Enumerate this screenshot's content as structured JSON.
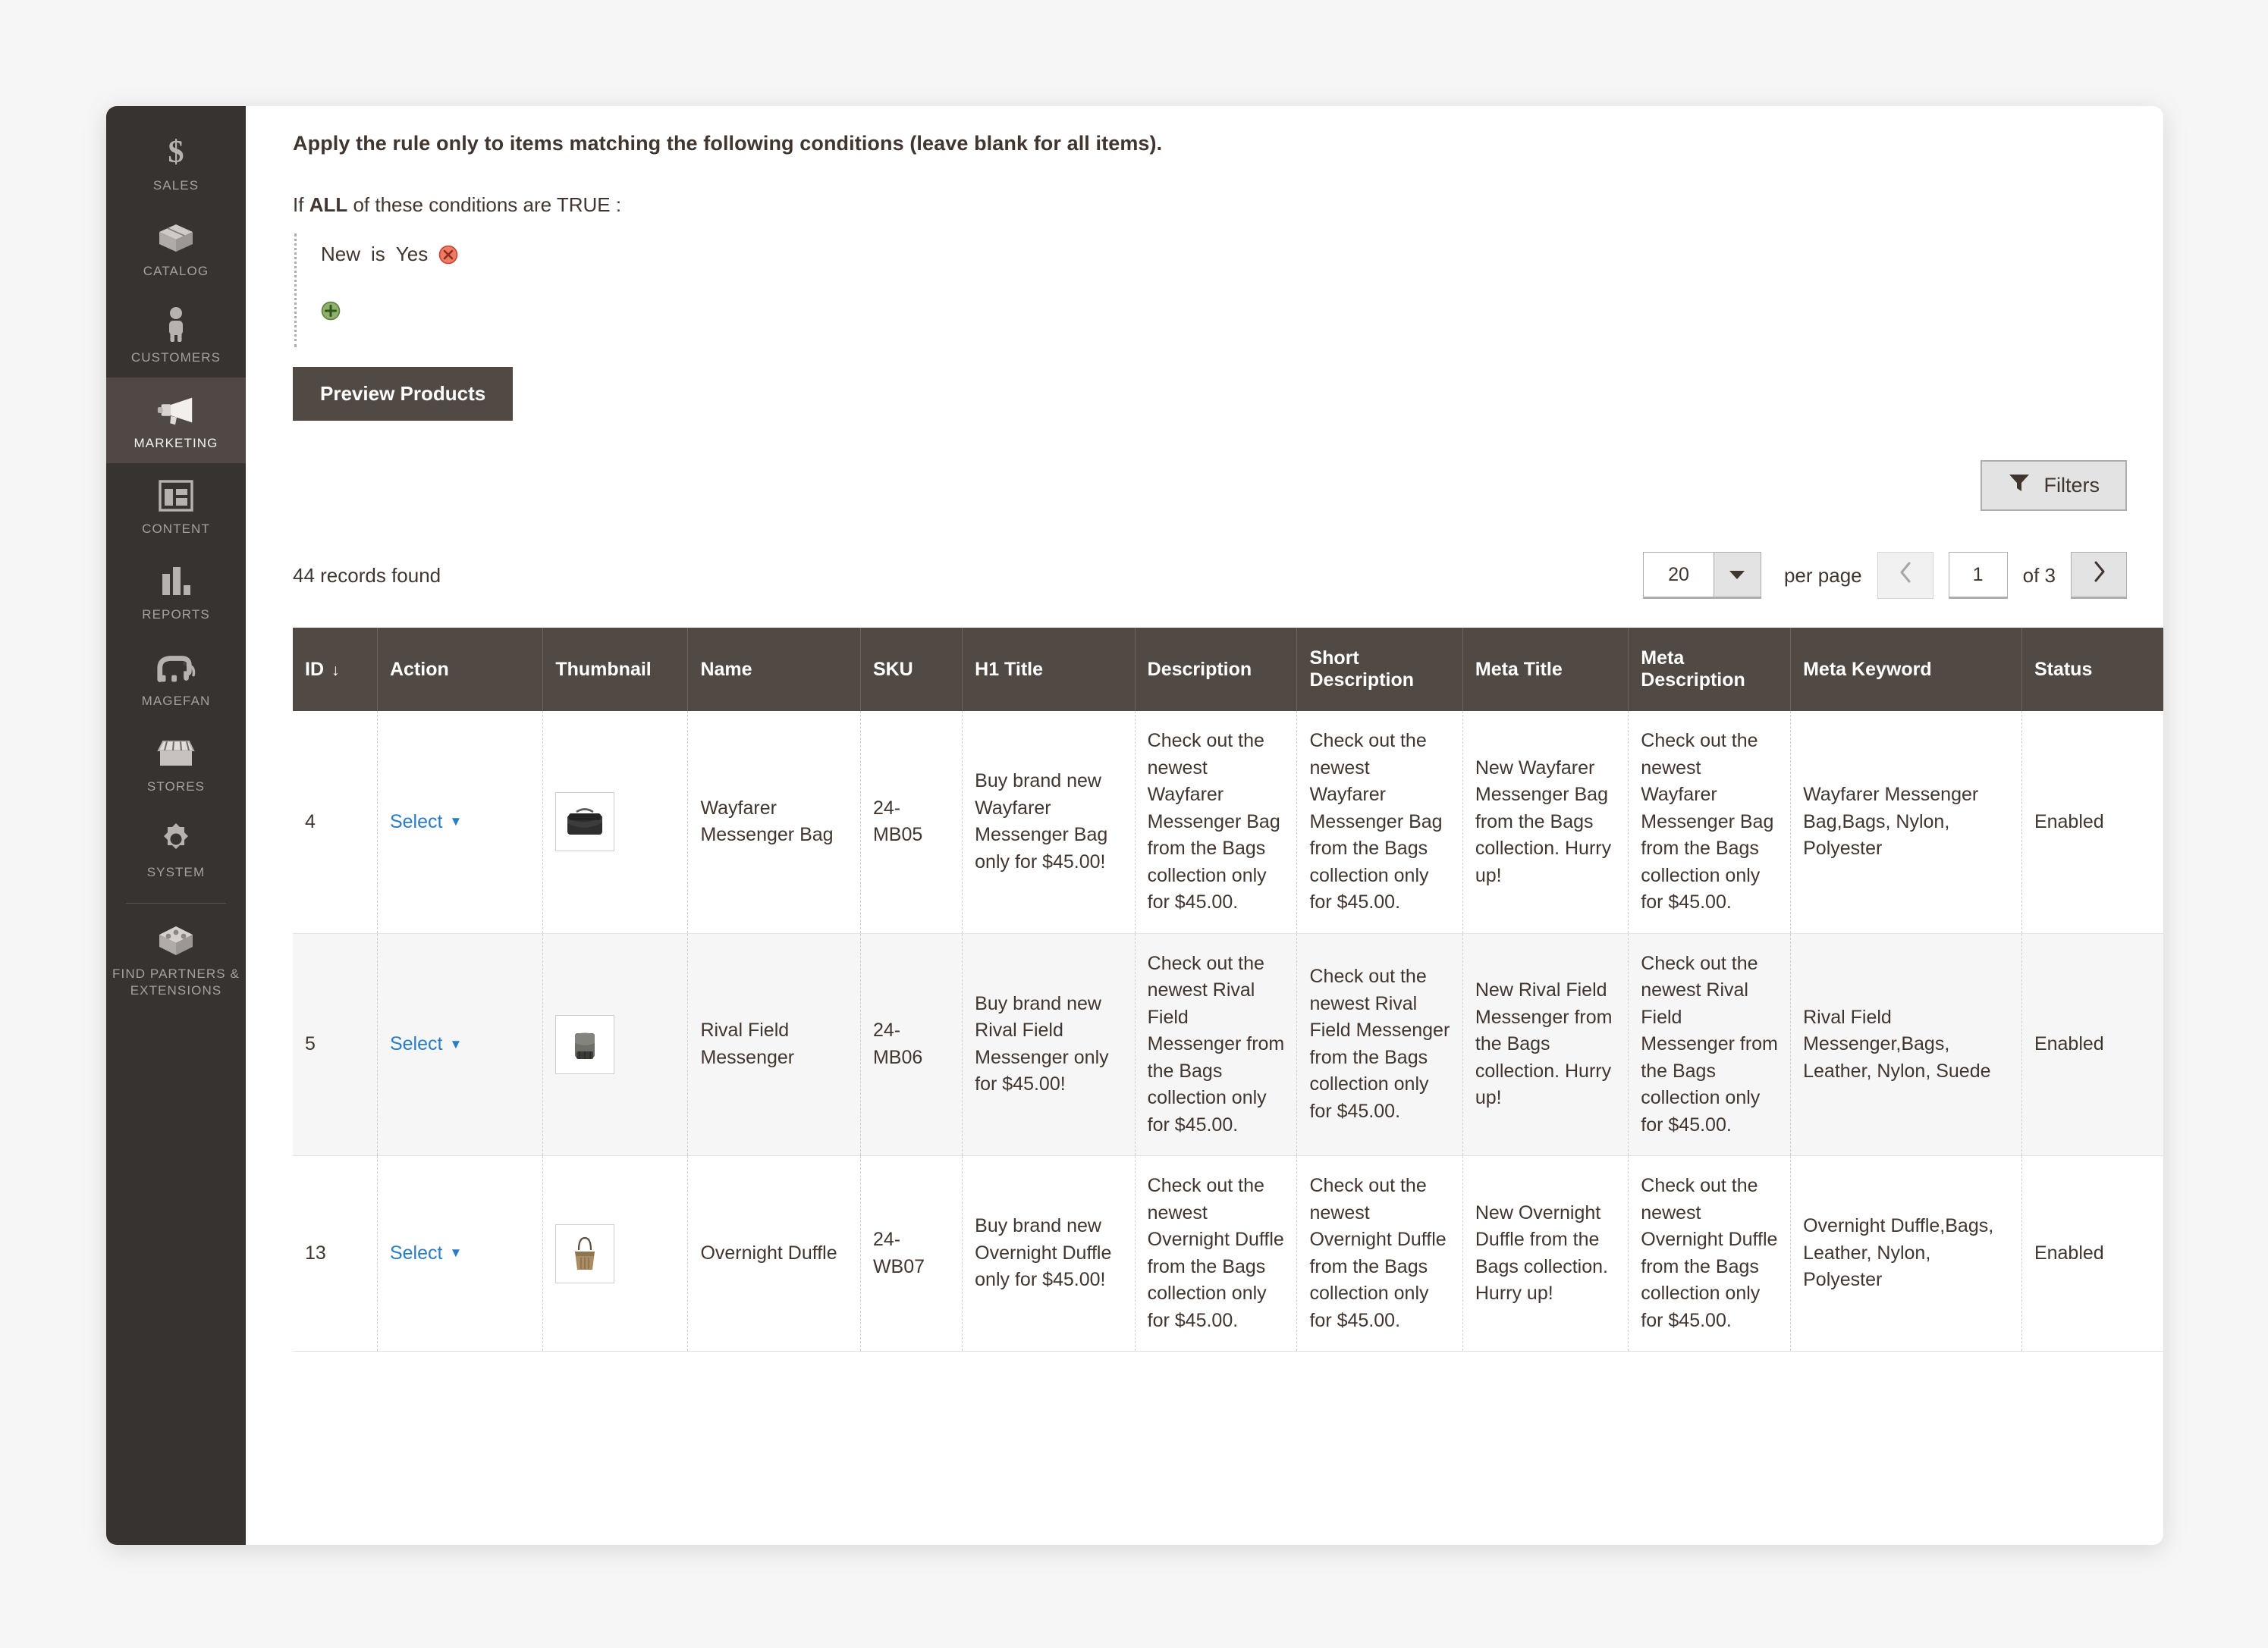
{
  "conditions": {
    "intro": "Apply the rule only to items matching the following conditions (leave blank for all items).",
    "if_prefix": "If",
    "aggregator": "ALL",
    "if_suffix": "of these conditions are TRUE :",
    "rows": [
      {
        "attribute": "New",
        "operator": "is",
        "value": "Yes",
        "remove_icon": "remove-circle-icon"
      }
    ],
    "add_icon": "add-circle-icon"
  },
  "actions": {
    "preview_products_label": "Preview Products"
  },
  "toolbar": {
    "filters_label": "Filters",
    "filters_icon": "filter-funnel-icon",
    "records_found": "44 records found",
    "per_page_value": "20",
    "per_page_label": "per page",
    "page_value": "1",
    "page_of": "of 3",
    "prev_icon": "chevron-left-icon",
    "next_icon": "chevron-right-icon",
    "caret_icon": "chevron-down-icon"
  },
  "grid": {
    "columns": [
      {
        "label": "ID",
        "sorted": true,
        "sort_icon": "arrow-down-icon"
      },
      {
        "label": "Action"
      },
      {
        "label": "Thumbnail"
      },
      {
        "label": "Name"
      },
      {
        "label": "SKU"
      },
      {
        "label": "H1 Title"
      },
      {
        "label": "Description"
      },
      {
        "label": "Short Description"
      },
      {
        "label": "Meta Title"
      },
      {
        "label": "Meta Description"
      },
      {
        "label": "Meta Keyword"
      },
      {
        "label": "Status"
      }
    ],
    "action_label": "Select",
    "rows": [
      {
        "id": "4",
        "thumbnail": "messenger-bag-black-thumbnail",
        "name": "Wayfarer Messenger Bag",
        "sku": "24-MB05",
        "h1_title": "Buy brand new Wayfarer Messenger Bag only for $45.00!",
        "description": "Check out the newest Wayfarer Messenger Bag from the Bags collection only for $45.00.",
        "short_description": "Check out the newest Wayfarer Messenger Bag from the Bags collection only for $45.00.",
        "meta_title": "New Wayfarer Messenger Bag from the Bags collection. Hurry up!",
        "meta_description": "Check out the newest Wayfarer Messenger Bag from the Bags collection only for $45.00.",
        "meta_keyword": "Wayfarer Messenger Bag,Bags, Nylon, Polyester",
        "status": "Enabled"
      },
      {
        "id": "5",
        "thumbnail": "field-messenger-grey-thumbnail",
        "name": "Rival Field Messenger",
        "sku": "24-MB06",
        "h1_title": "Buy brand new Rival Field Messenger only for $45.00!",
        "description": "Check out the newest Rival Field Messenger from the Bags collection only for $45.00.",
        "short_description": "Check out the newest Rival Field Messenger from the Bags collection only for $45.00.",
        "meta_title": "New Rival Field Messenger from the Bags collection. Hurry up!",
        "meta_description": "Check out the newest Rival Field Messenger from the Bags collection only for $45.00.",
        "meta_keyword": "Rival Field Messenger,Bags, Leather, Nylon, Suede",
        "status": "Enabled"
      },
      {
        "id": "13",
        "thumbnail": "overnight-duffle-tan-thumbnail",
        "name": "Overnight Duffle",
        "sku": "24-WB07",
        "h1_title": "Buy brand new Overnight Duffle only for $45.00!",
        "description": "Check out the newest Overnight Duffle from the Bags collection only for $45.00.",
        "short_description": "Check out the newest Overnight Duffle from the Bags collection only for $45.00.",
        "meta_title": "New Overnight Duffle from the Bags collection. Hurry up!",
        "meta_description": "Check out the newest Overnight Duffle from the Bags collection only for $45.00.",
        "meta_keyword": "Overnight Duffle,Bags, Leather, Nylon, Polyester",
        "status": "Enabled"
      }
    ]
  },
  "sidebar": {
    "items": [
      {
        "label": "SALES",
        "icon": "dollar-sign-icon",
        "active": false
      },
      {
        "label": "CATALOG",
        "icon": "box-icon",
        "active": false
      },
      {
        "label": "CUSTOMERS",
        "icon": "person-icon",
        "active": false
      },
      {
        "label": "MARKETING",
        "icon": "megaphone-icon",
        "active": true
      },
      {
        "label": "CONTENT",
        "icon": "layout-icon",
        "active": false
      },
      {
        "label": "REPORTS",
        "icon": "bar-chart-icon",
        "active": false
      },
      {
        "label": "MAGEFAN",
        "icon": "elephant-icon",
        "active": false
      },
      {
        "label": "STORES",
        "icon": "storefront-icon",
        "active": false
      },
      {
        "label": "SYSTEM",
        "icon": "gear-icon",
        "active": false
      },
      {
        "label": "FIND PARTNERS & EXTENSIONS",
        "icon": "extensions-box-icon",
        "active": false
      }
    ]
  },
  "colors": {
    "sidebar_bg": "#373330",
    "sidebar_active_bg": "#4f4845",
    "header_bg": "#514943",
    "link_blue": "#2a7cc7",
    "remove_red": "#e4604a",
    "add_green": "#6a9c4a"
  }
}
